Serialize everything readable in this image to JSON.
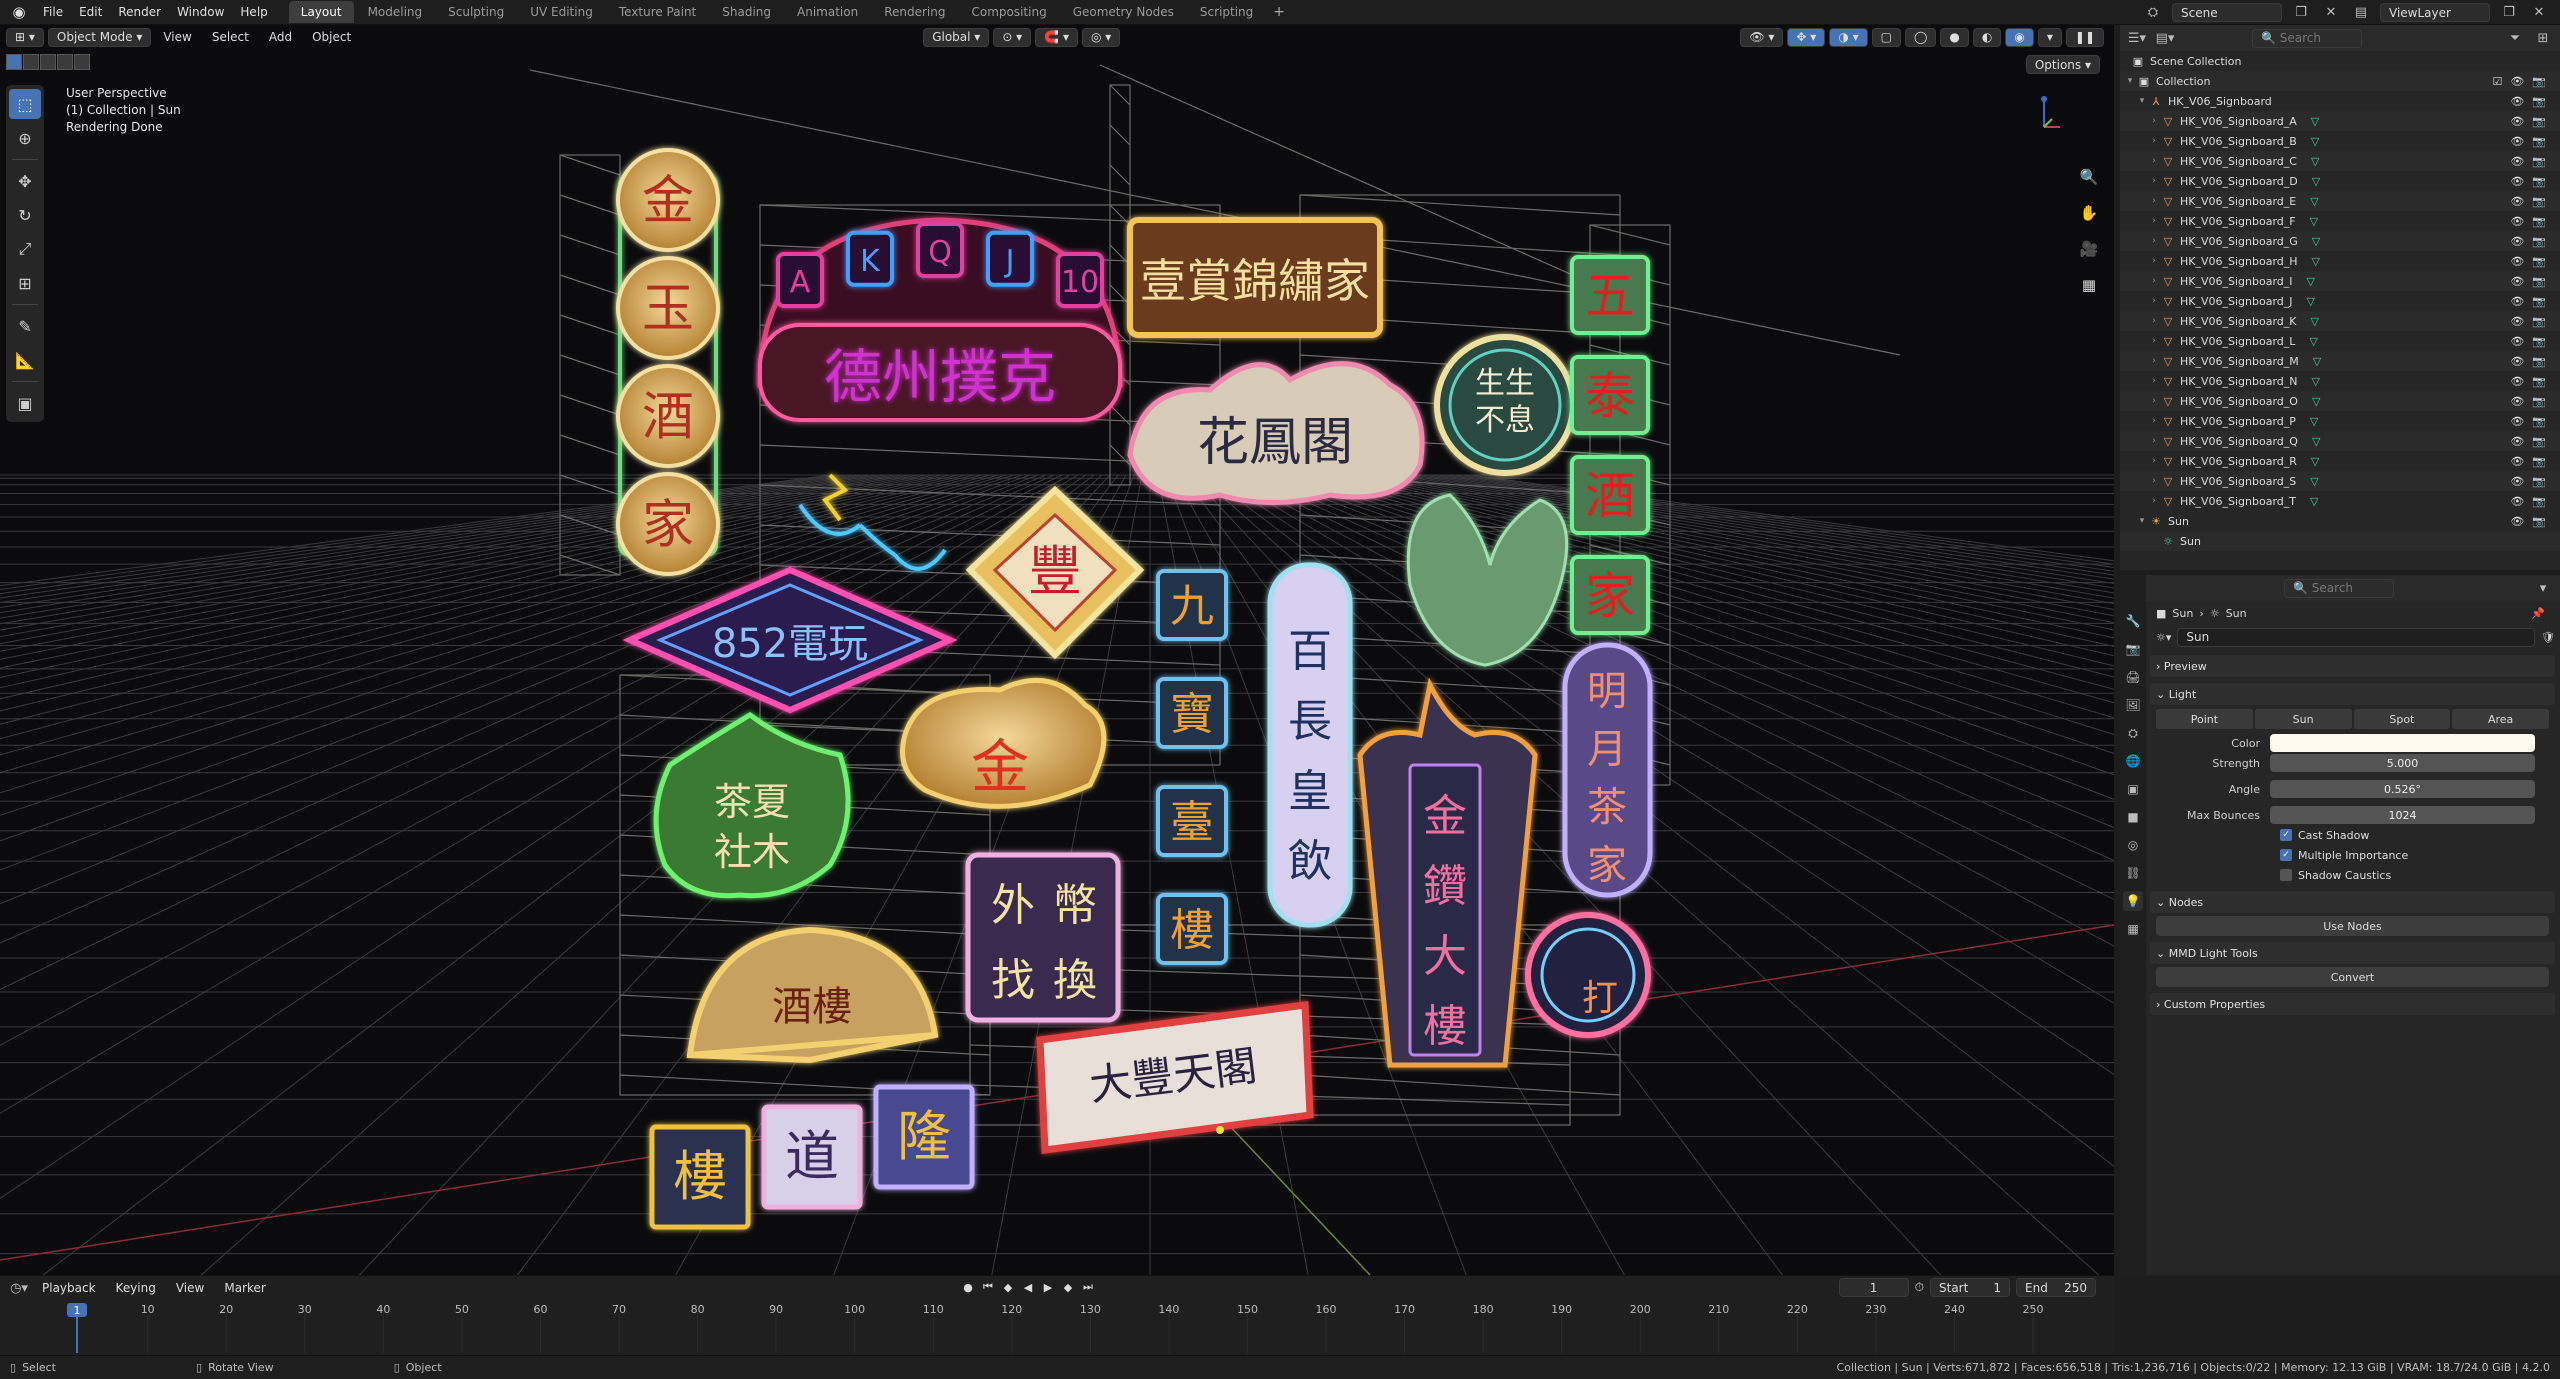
{
  "menu": [
    "File",
    "Edit",
    "Render",
    "Window",
    "Help"
  ],
  "workspaces": [
    {
      "label": "Layout",
      "active": true
    },
    {
      "label": "Modeling"
    },
    {
      "label": "Sculpting"
    },
    {
      "label": "UV Editing"
    },
    {
      "label": "Texture Paint"
    },
    {
      "label": "Shading"
    },
    {
      "label": "Animation"
    },
    {
      "label": "Rendering"
    },
    {
      "label": "Compositing"
    },
    {
      "label": "Geometry Nodes"
    },
    {
      "label": "Scripting"
    }
  ],
  "scene_field": "Scene",
  "viewlayer_field": "ViewLayer",
  "viewport": {
    "mode": "Object Mode",
    "menus": [
      "View",
      "Select",
      "Add",
      "Object"
    ],
    "orientation": "Global",
    "options_label": "Options",
    "info": [
      "User Perspective",
      "(1) Collection | Sun",
      "Rendering Done"
    ]
  },
  "signs": {
    "gold_column": [
      "金",
      "玉",
      "酒",
      "家"
    ],
    "poker_letters": [
      "A",
      "K",
      "Q",
      "J",
      "10"
    ],
    "arch_text": "德州撲克",
    "top_banner": "壹賞錦繡家",
    "cloud_text": "花鳳閣",
    "round_text": "生生不息",
    "right_column": [
      "五",
      "泰",
      "酒",
      "家"
    ],
    "diamond_text": "852電玩",
    "rhombus_text": "豐",
    "gold_ingot_text": "金",
    "blue_column": [
      "九",
      "寶",
      "臺",
      "樓"
    ],
    "long_vertical_text": "百長皇飲",
    "leaf_text": "茶夏社木",
    "exchange_text": "外幣找換",
    "fan_text": "酒樓",
    "mahjong_text": "大豐天閣",
    "ornate_vertical_text": "金鑽大樓",
    "oval_vertical_text": "明月茶家",
    "round_bottom_text": "打",
    "small_boxes": [
      "樓",
      "道",
      "隆"
    ]
  },
  "outliner": {
    "search_placeholder": "Search",
    "scene_collection": "Scene Collection",
    "collection": "Collection",
    "parent": "HK_V06_Signboard",
    "children": [
      "HK_V06_Signboard_A",
      "HK_V06_Signboard_B",
      "HK_V06_Signboard_C",
      "HK_V06_Signboard_D",
      "HK_V06_Signboard_E",
      "HK_V06_Signboard_F",
      "HK_V06_Signboard_G",
      "HK_V06_Signboard_H",
      "HK_V06_Signboard_I",
      "HK_V06_Signboard_J",
      "HK_V06_Signboard_K",
      "HK_V06_Signboard_L",
      "HK_V06_Signboard_M",
      "HK_V06_Signboard_N",
      "HK_V06_Signboard_O",
      "HK_V06_Signboard_P",
      "HK_V06_Signboard_Q",
      "HK_V06_Signboard_R",
      "HK_V06_Signboard_S",
      "HK_V06_Signboard_T"
    ],
    "sun_object": "Sun",
    "sun_data": "Sun"
  },
  "properties": {
    "search_placeholder": "Search",
    "breadcrumb_object": "Sun",
    "breadcrumb_data": "Sun",
    "data_name": "Sun",
    "sections": {
      "preview": "Preview",
      "light": "Light",
      "nodes": "Nodes",
      "mmd": "MMD Light Tools",
      "custom": "Custom Properties"
    },
    "light_types": [
      "Point",
      "Sun",
      "Spot",
      "Area"
    ],
    "active_light_type": "Sun",
    "color_label": "Color",
    "strength_label": "Strength",
    "strength": "5.000",
    "angle_label": "Angle",
    "angle": "0.526°",
    "bounces_label": "Max Bounces",
    "bounces": "1024",
    "cast_shadow": "Cast Shadow",
    "multiple_importance": "Multiple Importance",
    "shadow_caustics": "Shadow Caustics",
    "use_nodes": "Use Nodes",
    "convert": "Convert",
    "light_color": "#fffaf0"
  },
  "timeline": {
    "menus": [
      "Playback",
      "Keying",
      "View",
      "Marker"
    ],
    "current_frame": "1",
    "start_label": "Start",
    "start": "1",
    "end_label": "End",
    "end": "250",
    "ticks": [
      "1",
      "10",
      "20",
      "30",
      "40",
      "50",
      "60",
      "70",
      "80",
      "90",
      "100",
      "110",
      "120",
      "130",
      "140",
      "150",
      "160",
      "170",
      "180",
      "190",
      "200",
      "210",
      "220",
      "230",
      "240",
      "250"
    ]
  },
  "statusbar": {
    "select": "Select",
    "rotate": "Rotate View",
    "object": "Object",
    "stats": "Collection | Sun | Verts:671,872 | Faces:656,518 | Tris:1,236,716 | Objects:0/22 | Memory: 12.13 GiB | VRAM: 18.7/24.0 GiB | 4.2.0"
  }
}
